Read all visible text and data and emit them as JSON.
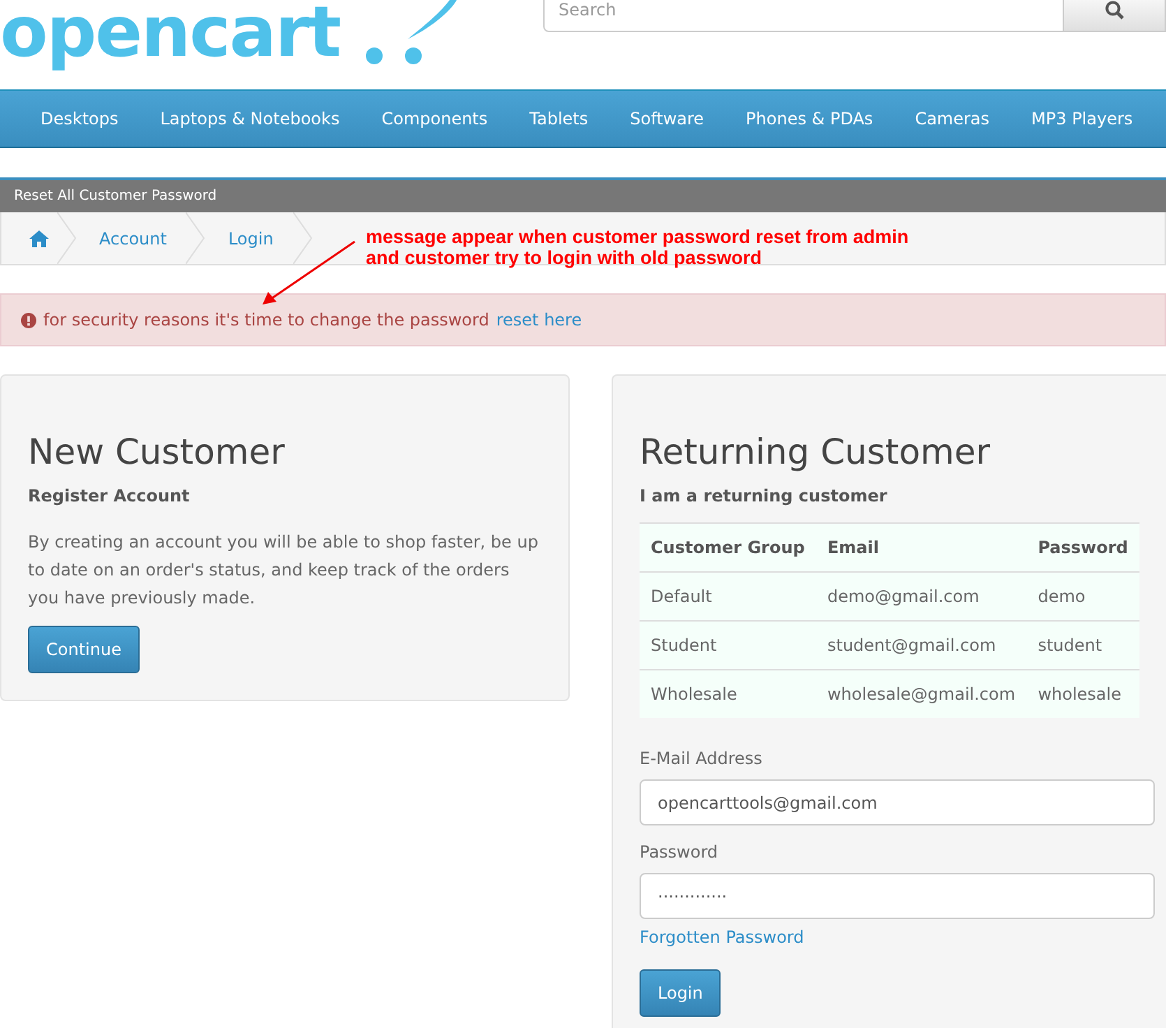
{
  "header": {
    "logo": "opencart",
    "search": {
      "placeholder": "Search"
    }
  },
  "menu": [
    {
      "label": "Desktops"
    },
    {
      "label": "Laptops & Notebooks"
    },
    {
      "label": "Components"
    },
    {
      "label": "Tablets"
    },
    {
      "label": "Software"
    },
    {
      "label": "Phones & PDAs"
    },
    {
      "label": "Cameras"
    },
    {
      "label": "MP3 Players"
    }
  ],
  "notice_bar": "Reset All Customer Password",
  "breadcrumb": [
    "Account",
    "Login"
  ],
  "annotation": [
    "message appear when customer password reset from admin",
    "and customer try to login with old password"
  ],
  "alert": {
    "text": "for security reasons it's time to change the password",
    "link": "reset here"
  },
  "new_customer": {
    "title": "New Customer",
    "subtitle": "Register Account",
    "text": "By creating an account you will be able to shop faster, be up to date on an order's status, and keep track of the orders you have previously made.",
    "button": "Continue"
  },
  "returning_customer": {
    "title": "Returning Customer",
    "subtitle": "I am a returning customer",
    "table": {
      "columns": [
        "Customer Group",
        "Email",
        "Password"
      ],
      "rows": [
        [
          "Default",
          "demo@gmail.com",
          "demo"
        ],
        [
          "Student",
          "student@gmail.com",
          "student"
        ],
        [
          "Wholesale",
          "wholesale@gmail.com",
          "wholesale"
        ]
      ]
    },
    "email_label": "E-Mail Address",
    "email_value": "opencarttools@gmail.com",
    "password_label": "Password",
    "password_value": "·············",
    "forgotten": "Forgotten Password",
    "button": "Login"
  }
}
